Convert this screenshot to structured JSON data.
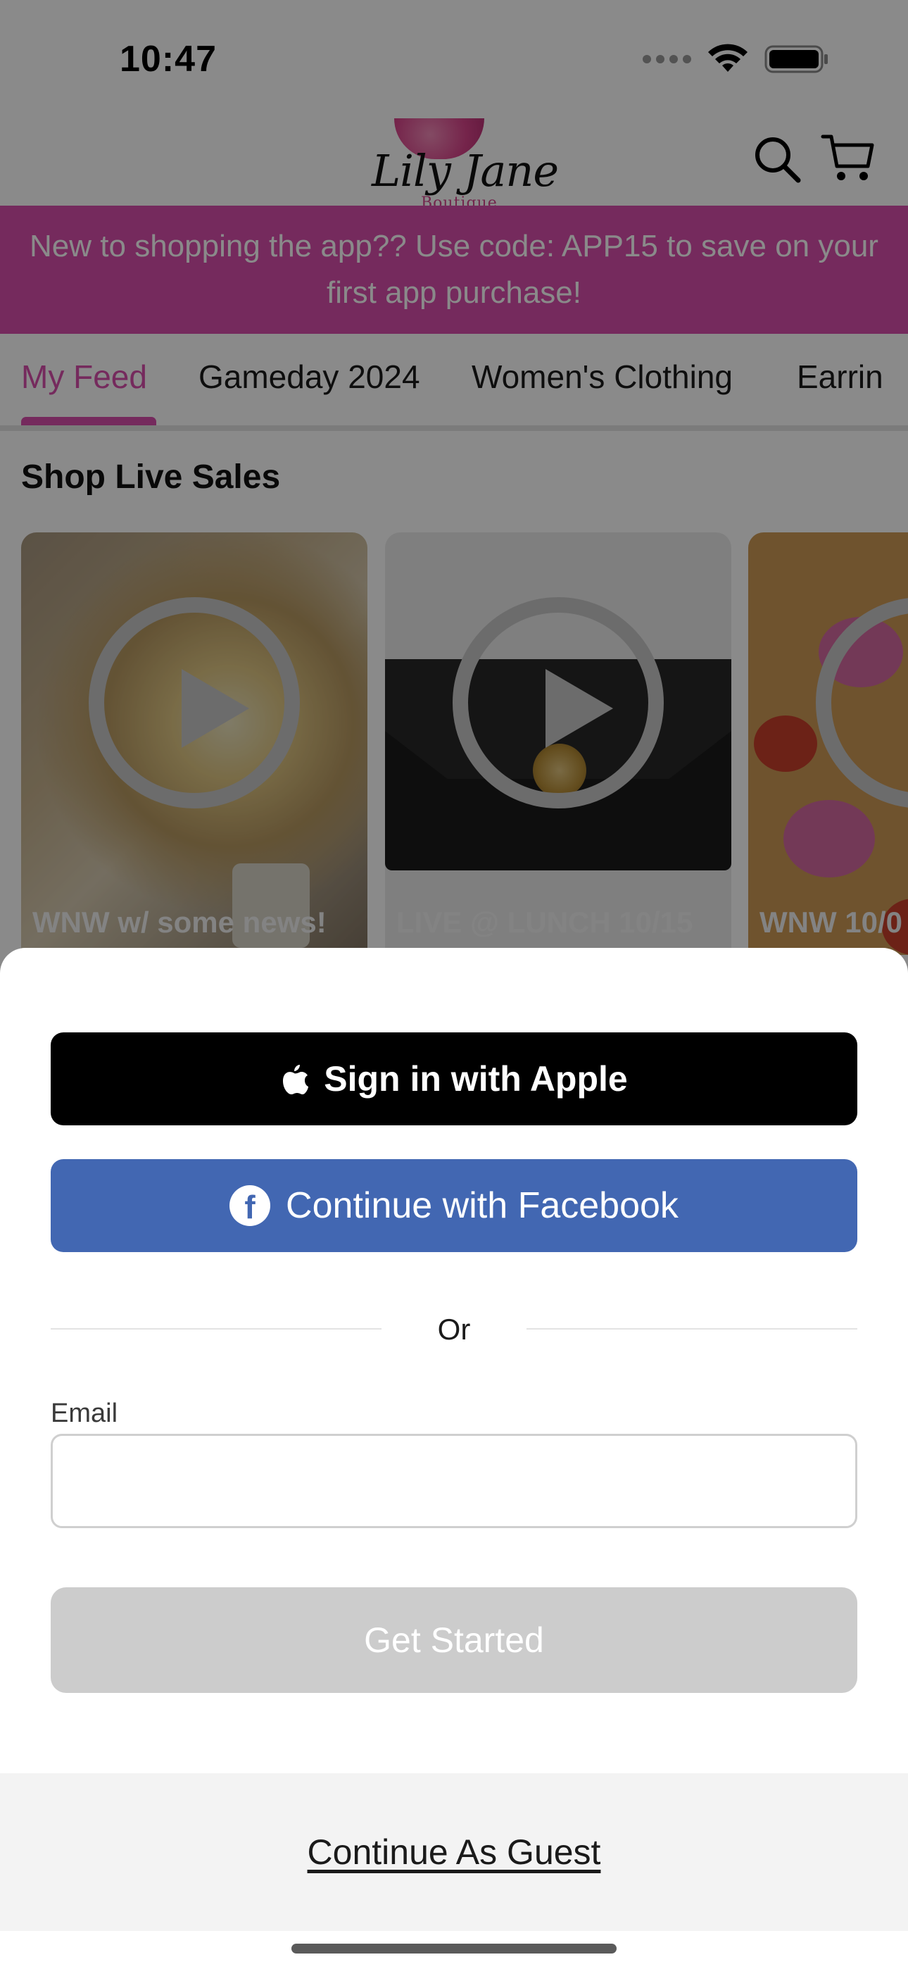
{
  "status_bar": {
    "time": "10:47",
    "icons": [
      "cellular-signal-icon",
      "wifi-icon",
      "battery-icon"
    ]
  },
  "header": {
    "logo_text": "Lily Jane",
    "logo_subtext": "Boutique",
    "icons": [
      "search-icon",
      "cart-icon"
    ]
  },
  "promo": {
    "text": "New to shopping the app?? Use code: APP15 to save on your first app purchase!",
    "color": "#d84fad"
  },
  "tabs": [
    {
      "label": "My Feed",
      "active": true
    },
    {
      "label": "Gameday 2024",
      "active": false
    },
    {
      "label": "Women's Clothing",
      "active": false
    },
    {
      "label": "Earrin",
      "active": false
    }
  ],
  "live_sales": {
    "title": "Shop Live Sales",
    "cards": [
      {
        "caption": "WNW w/ some news!"
      },
      {
        "caption": "LIVE @ LUNCH 10/15"
      },
      {
        "caption": "WNW 10/0"
      }
    ]
  },
  "auth_sheet": {
    "apple_label": "Sign in with Apple",
    "facebook_label": "Continue with Facebook",
    "or_label": "Or",
    "email_label": "Email",
    "email_value": "",
    "email_placeholder": "",
    "get_started_label": "Get Started",
    "guest_label": "Continue As Guest",
    "colors": {
      "apple": "#000000",
      "facebook": "#4267b2",
      "get_started_disabled": "#cccccc"
    }
  }
}
